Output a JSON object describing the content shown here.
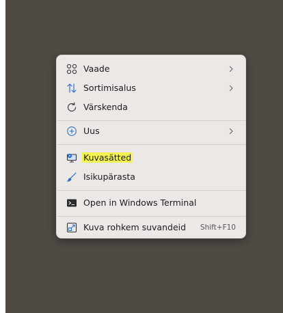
{
  "menu": {
    "items": [
      {
        "label": "Vaade",
        "icon": "grid-icon",
        "has_submenu": true
      },
      {
        "label": "Sortimisalus",
        "icon": "sort-arrows-icon",
        "has_submenu": true
      },
      {
        "label": "Värskenda",
        "icon": "refresh-icon",
        "has_submenu": false
      },
      {
        "label": "Uus",
        "icon": "plus-circle-icon",
        "has_submenu": true
      },
      {
        "label": "Kuvasätted",
        "icon": "display-settings-icon",
        "has_submenu": false,
        "highlighted": true
      },
      {
        "label": "Isikupärasta",
        "icon": "brush-icon",
        "has_submenu": false
      },
      {
        "label": "Open in Windows Terminal",
        "icon": "terminal-icon",
        "has_submenu": false
      },
      {
        "label": "Kuva rohkem suvandeid",
        "icon": "more-options-icon",
        "has_submenu": false,
        "shortcut": "Shift+F10"
      }
    ]
  },
  "colors": {
    "desktop": "#504a45",
    "menu_background": "#ebe8e5",
    "highlight": "#f3f351",
    "accent": "#2f6fd0"
  }
}
